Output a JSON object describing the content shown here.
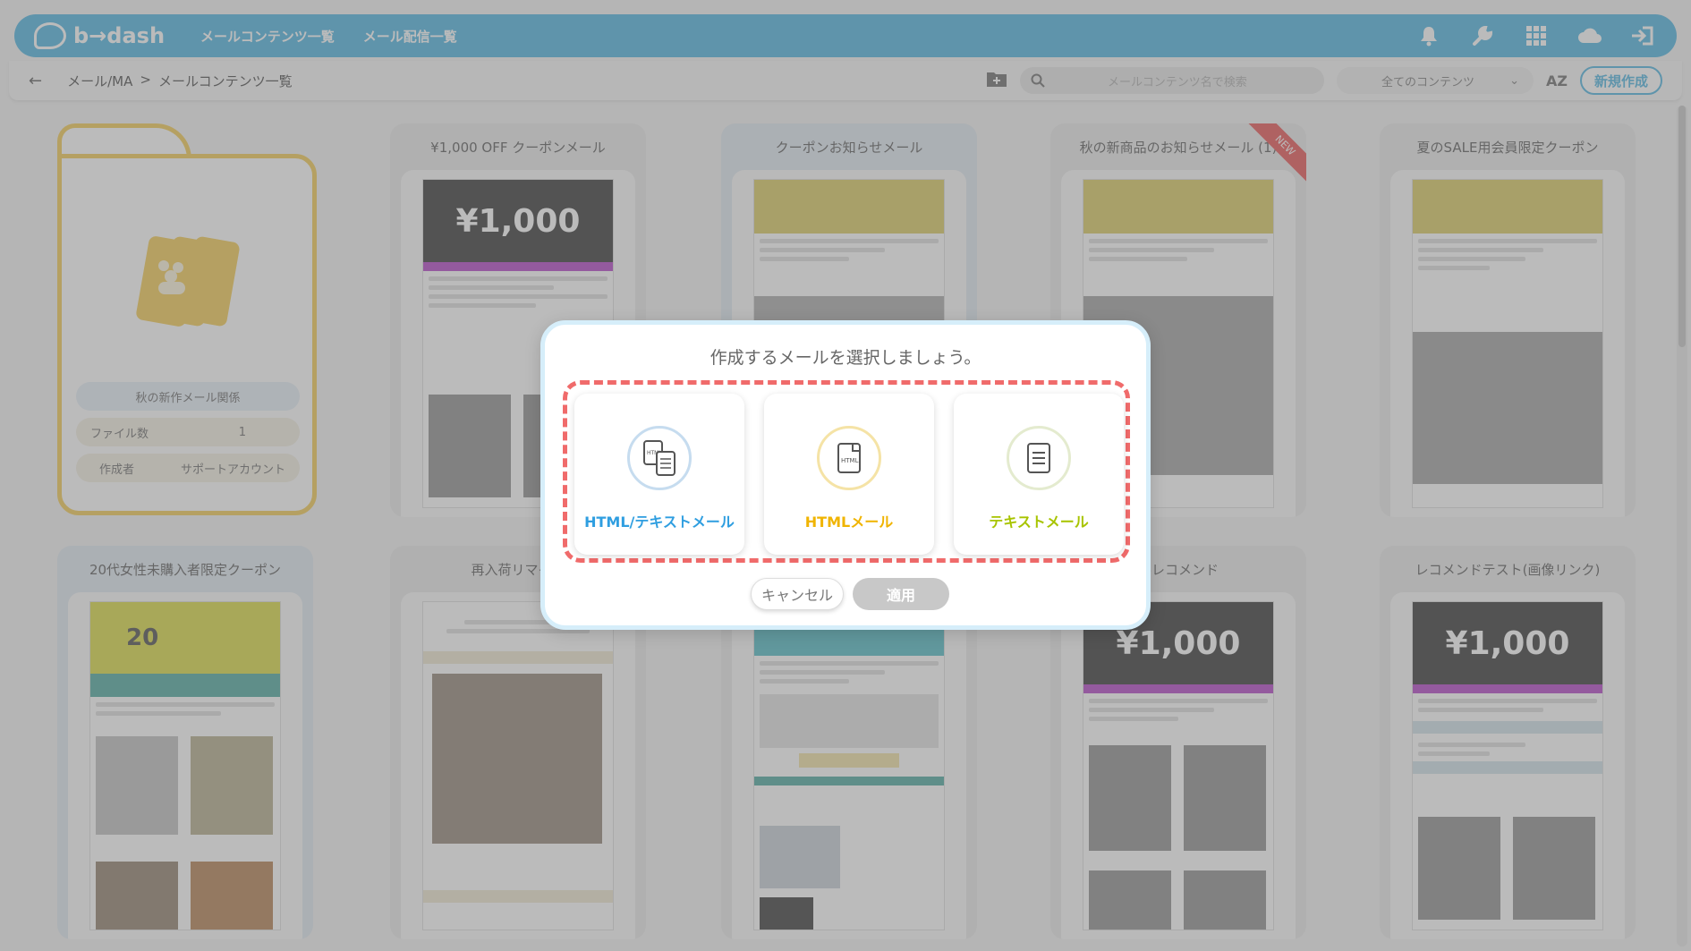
{
  "header": {
    "logo_text": "b→dash",
    "nav": [
      "メールコンテンツ一覧",
      "メール配信一覧"
    ],
    "icons": [
      "bell-icon",
      "wrench-icon",
      "grid-icon",
      "cloud-icon",
      "logout-icon"
    ]
  },
  "toolbar": {
    "back": "←",
    "breadcrumb_root": "メール/MA",
    "breadcrumb_sep": ">",
    "breadcrumb_current": "メールコンテンツ一覧",
    "search_placeholder": "メールコンテンツ名で検索",
    "filter_value": "全てのコンテンツ",
    "sort_label": "AZ",
    "new_button": "新規作成"
  },
  "folder": {
    "name": "秋の新作メール関係",
    "file_count_label": "ファイル数",
    "file_count": "1",
    "creator_label": "作成者",
    "creator": "サポートアカウント"
  },
  "cards": [
    {
      "title": "¥1,000 OFF クーポンメール",
      "hero": "¥1,000"
    },
    {
      "title": "クーポンお知らせメール",
      "hero": ""
    },
    {
      "title": "秋の新商品のお知らせメール (1)",
      "hero": "",
      "badge": "NEW"
    },
    {
      "title": "夏のSALE用会員限定クーポン",
      "hero": ""
    },
    {
      "title": "20代女性未購入者限定クーポン",
      "hero": "20"
    },
    {
      "title": "再入荷リマイン",
      "hero": ""
    },
    {
      "title": "",
      "hero": ""
    },
    {
      "title": "ルレコメンド",
      "hero": "¥1,000"
    },
    {
      "title": "レコメンドテスト(画像リンク)",
      "hero": "¥1,000"
    }
  ],
  "modal": {
    "title": "作成するメールを選択しましょう。",
    "options": [
      {
        "label": "HTML/テキストメール",
        "color": "#2f9ee0"
      },
      {
        "label": "HTMLメール",
        "color": "#f0b400"
      },
      {
        "label": "テキストメール",
        "color": "#a8c400"
      }
    ],
    "cancel": "キャンセル",
    "apply": "適用"
  }
}
